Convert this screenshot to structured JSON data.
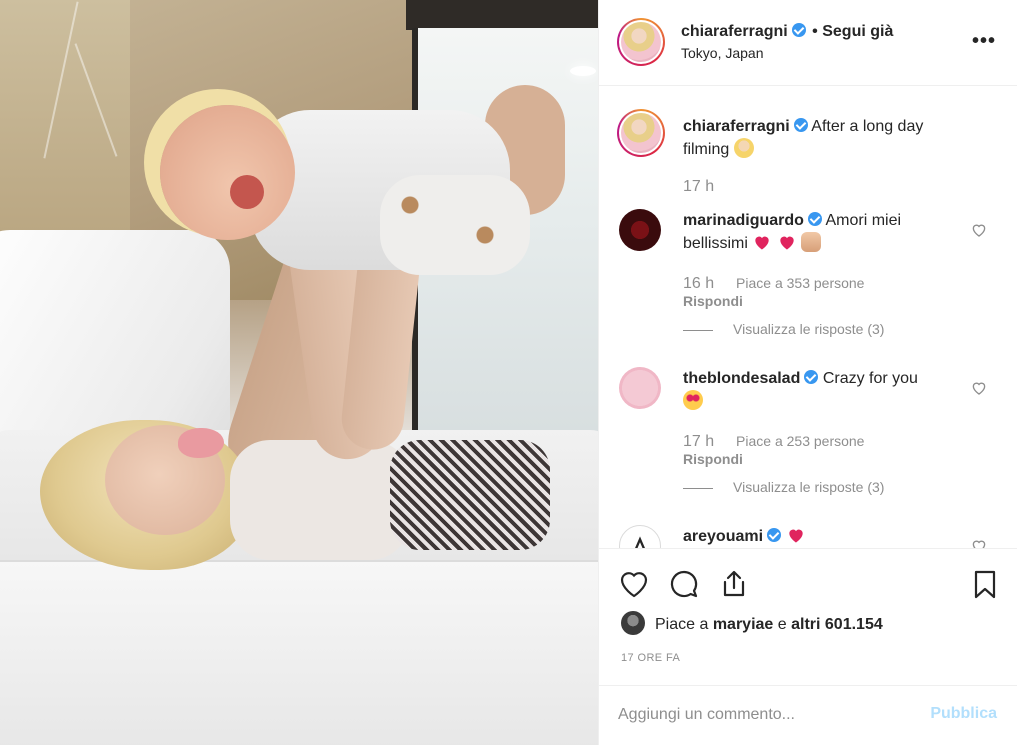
{
  "post": {
    "username": "chiaraferragni",
    "follow_state": "• Segui già",
    "location": "Tokyo, Japan",
    "more": "•••"
  },
  "caption": {
    "username": "chiaraferragni",
    "text": "After a long day filming",
    "time": "17 h"
  },
  "comments": [
    {
      "username": "marinadiguardo",
      "text": "Amori miei bellissimi",
      "time": "16 h",
      "likes": "Piace a 353 persone",
      "reply": "Rispondi",
      "replies": "Visualizza le risposte (3)"
    },
    {
      "username": "theblondesalad",
      "text": "Crazy for you",
      "time": "17 h",
      "likes": "Piace a 253 persone",
      "reply": "Rispondi",
      "replies": "Visualizza le risposte (3)"
    },
    {
      "username": "areyouami",
      "text": ""
    }
  ],
  "likes": {
    "prefix": "Piace a ",
    "user": "maryiae",
    "middle": " e ",
    "others": "altri 601.154"
  },
  "time_ago": "17 ORE FA",
  "add_comment": {
    "placeholder": "Aggiungi un commento...",
    "publish": "Pubblica"
  },
  "colors": {
    "verified": "#3897f0",
    "publish_disabled": "#b2dffc",
    "secondary_text": "#8e8e8e"
  }
}
